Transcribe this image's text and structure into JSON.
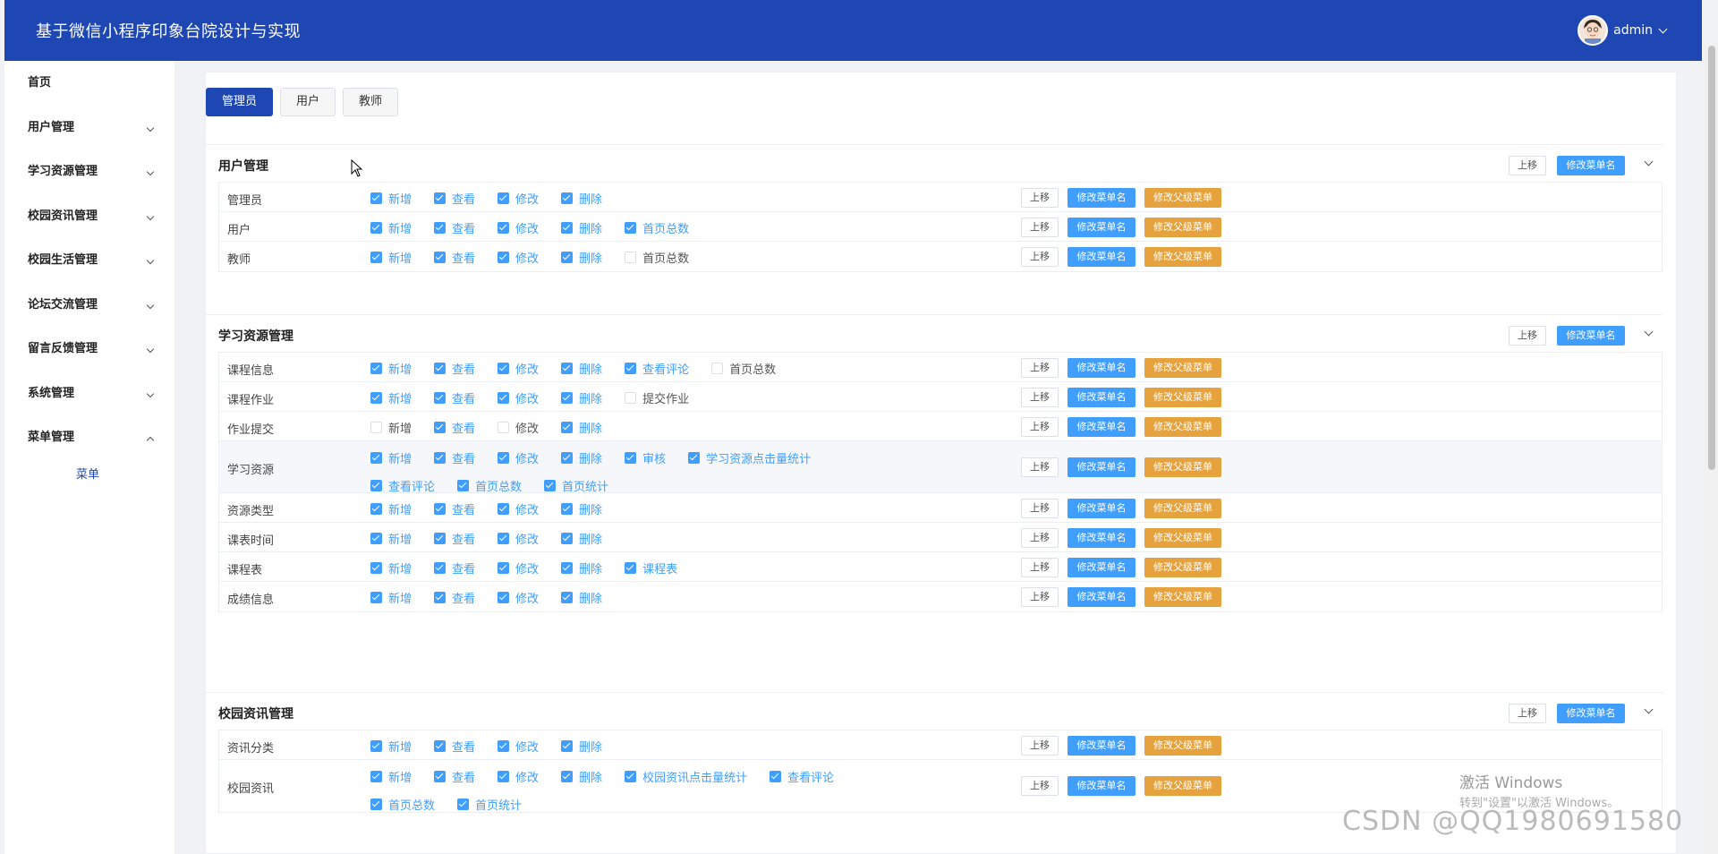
{
  "app": {
    "title": "基于微信小程序印象台院设计与实现",
    "user_name": "admin"
  },
  "sidebar": {
    "items": [
      {
        "label": "首页",
        "expandable": false
      },
      {
        "label": "用户管理",
        "expandable": true,
        "expanded": false
      },
      {
        "label": "学习资源管理",
        "expandable": true,
        "expanded": false
      },
      {
        "label": "校园资讯管理",
        "expandable": true,
        "expanded": false
      },
      {
        "label": "校园生活管理",
        "expandable": true,
        "expanded": false
      },
      {
        "label": "论坛交流管理",
        "expandable": true,
        "expanded": false
      },
      {
        "label": "留言反馈管理",
        "expandable": true,
        "expanded": false
      },
      {
        "label": "系统管理",
        "expandable": true,
        "expanded": false
      },
      {
        "label": "菜单管理",
        "expandable": true,
        "expanded": true
      }
    ],
    "sub_item": "菜单"
  },
  "tabs": [
    {
      "label": "管理员",
      "active": true
    },
    {
      "label": "用户",
      "active": false
    },
    {
      "label": "教师",
      "active": false
    }
  ],
  "buttons": {
    "move_up": "上移",
    "rename_menu": "修改菜单名",
    "edit_parent": "修改父级菜单"
  },
  "groups": [
    {
      "title": "用户管理",
      "rows": [
        {
          "name": "管理员",
          "perms": [
            {
              "label": "新增",
              "checked": true
            },
            {
              "label": "查看",
              "checked": true
            },
            {
              "label": "修改",
              "checked": true
            },
            {
              "label": "删除",
              "checked": true
            }
          ]
        },
        {
          "name": "用户",
          "perms": [
            {
              "label": "新增",
              "checked": true
            },
            {
              "label": "查看",
              "checked": true
            },
            {
              "label": "修改",
              "checked": true
            },
            {
              "label": "删除",
              "checked": true
            },
            {
              "label": "首页总数",
              "checked": true
            }
          ]
        },
        {
          "name": "教师",
          "perms": [
            {
              "label": "新增",
              "checked": true
            },
            {
              "label": "查看",
              "checked": true
            },
            {
              "label": "修改",
              "checked": true
            },
            {
              "label": "删除",
              "checked": true
            },
            {
              "label": "首页总数",
              "checked": false
            }
          ]
        }
      ]
    },
    {
      "title": "学习资源管理",
      "rows": [
        {
          "name": "课程信息",
          "perms": [
            {
              "label": "新增",
              "checked": true
            },
            {
              "label": "查看",
              "checked": true
            },
            {
              "label": "修改",
              "checked": true
            },
            {
              "label": "删除",
              "checked": true
            },
            {
              "label": "查看评论",
              "checked": true
            },
            {
              "label": "首页总数",
              "checked": false
            }
          ]
        },
        {
          "name": "课程作业",
          "perms": [
            {
              "label": "新增",
              "checked": true
            },
            {
              "label": "查看",
              "checked": true
            },
            {
              "label": "修改",
              "checked": true
            },
            {
              "label": "删除",
              "checked": true
            },
            {
              "label": "提交作业",
              "checked": false
            }
          ]
        },
        {
          "name": "作业提交",
          "perms": [
            {
              "label": "新增",
              "checked": false
            },
            {
              "label": "查看",
              "checked": true
            },
            {
              "label": "修改",
              "checked": false
            },
            {
              "label": "删除",
              "checked": true
            }
          ]
        },
        {
          "name": "学习资源",
          "highlight": true,
          "perms": [
            {
              "label": "新增",
              "checked": true
            },
            {
              "label": "查看",
              "checked": true
            },
            {
              "label": "修改",
              "checked": true
            },
            {
              "label": "删除",
              "checked": true
            },
            {
              "label": "审核",
              "checked": true
            },
            {
              "label": "学习资源点击量统计",
              "checked": true
            },
            {
              "label": "查看评论",
              "checked": true
            },
            {
              "label": "首页总数",
              "checked": true
            },
            {
              "label": "首页统计",
              "checked": true
            }
          ]
        },
        {
          "name": "资源类型",
          "perms": [
            {
              "label": "新增",
              "checked": true
            },
            {
              "label": "查看",
              "checked": true
            },
            {
              "label": "修改",
              "checked": true
            },
            {
              "label": "删除",
              "checked": true
            }
          ]
        },
        {
          "name": "课表时间",
          "perms": [
            {
              "label": "新增",
              "checked": true
            },
            {
              "label": "查看",
              "checked": true
            },
            {
              "label": "修改",
              "checked": true
            },
            {
              "label": "删除",
              "checked": true
            }
          ]
        },
        {
          "name": "课程表",
          "perms": [
            {
              "label": "新增",
              "checked": true
            },
            {
              "label": "查看",
              "checked": true
            },
            {
              "label": "修改",
              "checked": true
            },
            {
              "label": "删除",
              "checked": true
            },
            {
              "label": "课程表",
              "checked": true
            }
          ]
        },
        {
          "name": "成绩信息",
          "perms": [
            {
              "label": "新增",
              "checked": true
            },
            {
              "label": "查看",
              "checked": true
            },
            {
              "label": "修改",
              "checked": true
            },
            {
              "label": "删除",
              "checked": true
            }
          ]
        }
      ]
    },
    {
      "title": "校园资讯管理",
      "rows": [
        {
          "name": "资讯分类",
          "perms": [
            {
              "label": "新增",
              "checked": true
            },
            {
              "label": "查看",
              "checked": true
            },
            {
              "label": "修改",
              "checked": true
            },
            {
              "label": "删除",
              "checked": true
            }
          ]
        },
        {
          "name": "校园资讯",
          "perms": [
            {
              "label": "新增",
              "checked": true
            },
            {
              "label": "查看",
              "checked": true
            },
            {
              "label": "修改",
              "checked": true
            },
            {
              "label": "删除",
              "checked": true
            },
            {
              "label": "校园资讯点击量统计",
              "checked": true
            },
            {
              "label": "查看评论",
              "checked": true
            },
            {
              "label": "首页总数",
              "checked": true
            },
            {
              "label": "首页统计",
              "checked": true
            }
          ]
        }
      ]
    }
  ],
  "watermarks": {
    "activate_title": "激活 Windows",
    "activate_sub": "转到\"设置\"以激活 Windows。",
    "csdn": "CSDN @QQ1980691580"
  }
}
